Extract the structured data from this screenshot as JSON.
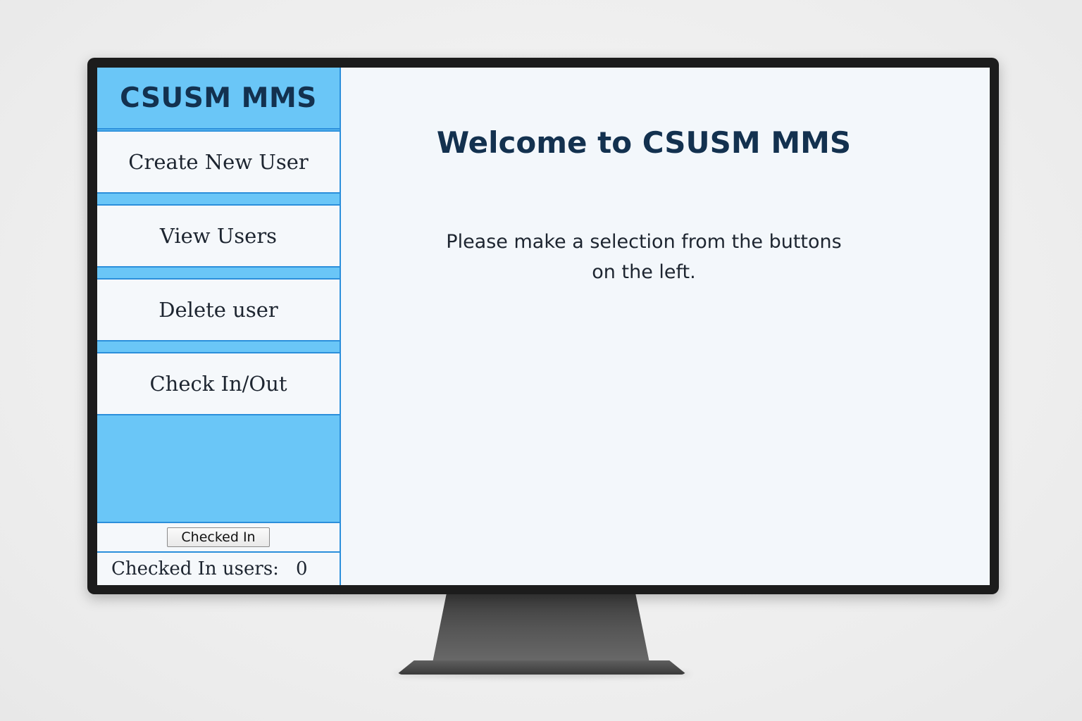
{
  "app": {
    "title": "CSUSM MMS"
  },
  "sidebar": {
    "items": [
      {
        "label": "Create New User"
      },
      {
        "label": "View Users"
      },
      {
        "label": "Delete user"
      },
      {
        "label": "Check In/Out"
      }
    ],
    "checked_in_button": "Checked In",
    "checked_in_count_label": "Checked In users:",
    "checked_in_count": "0"
  },
  "main": {
    "welcome": "Welcome to CSUSM MMS",
    "instructions": "Please make a selection from the buttons on the left."
  },
  "colors": {
    "sidebar_blue": "#6ac6f7",
    "border_blue": "#2b8fdb",
    "title_navy": "#13314f",
    "screen_bg": "#f3f7fb"
  }
}
